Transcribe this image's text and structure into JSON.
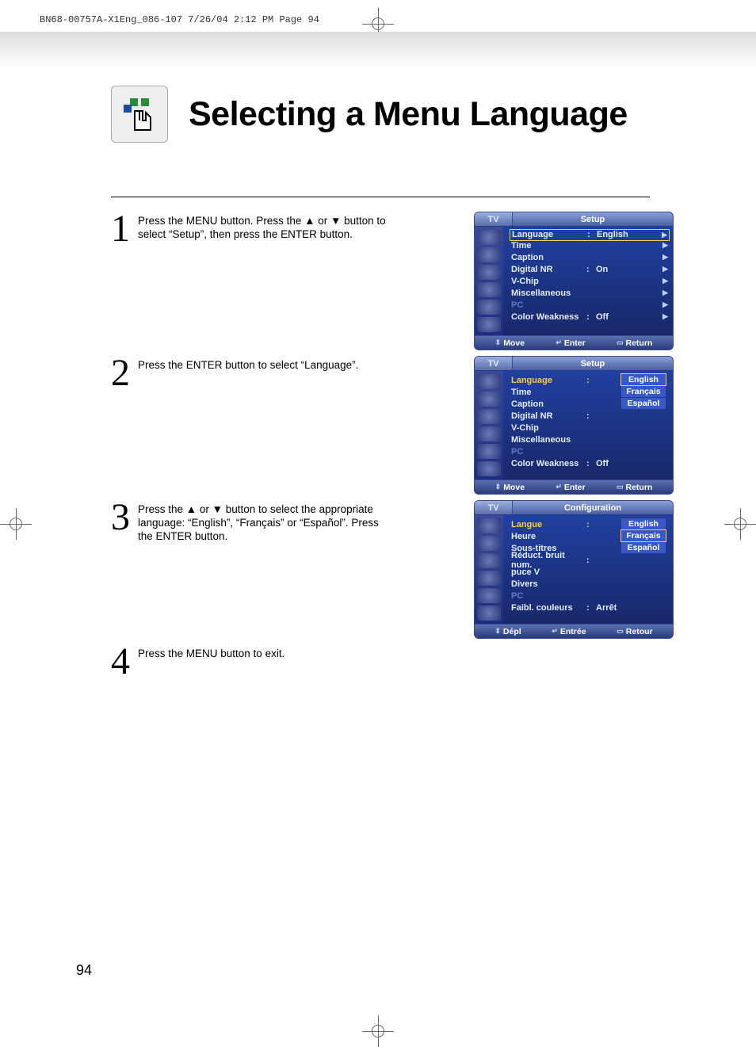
{
  "crop_header": "BN68-00757A-X1Eng_086-107  7/26/04  2:12 PM  Page 94",
  "page_title": "Selecting a Menu Language",
  "page_number": "94",
  "steps": {
    "s1": {
      "num": "1",
      "text": "Press the MENU button. Press the ▲ or ▼ button to select “Setup”, then press the ENTER button."
    },
    "s2": {
      "num": "2",
      "text": "Press the ENTER button to select “Language”."
    },
    "s3": {
      "num": "3",
      "text": "Press the ▲ or ▼ button to select the appropriate language: “English”, “Français” or “Español”. Press the ENTER button."
    },
    "s4": {
      "num": "4",
      "text": "Press the MENU button to exit."
    }
  },
  "osd1": {
    "tv": "TV",
    "title": "Setup",
    "rows": [
      {
        "label": "Language",
        "colon": ":",
        "val": "English",
        "arrow": "▶",
        "boxed": true
      },
      {
        "label": "Time",
        "arrow": "▶"
      },
      {
        "label": "Caption",
        "arrow": "▶"
      },
      {
        "label": "Digital NR",
        "colon": ":",
        "val": "On",
        "arrow": "▶"
      },
      {
        "label": "V-Chip",
        "arrow": "▶"
      },
      {
        "label": "Miscellaneous",
        "arrow": "▶"
      },
      {
        "label": "PC",
        "arrow": "▶",
        "dim": true
      },
      {
        "label": "Color Weakness",
        "colon": ":",
        "val": "Off",
        "arrow": "▶"
      }
    ],
    "hints": {
      "move": "Move",
      "enter": "Enter",
      "return": "Return"
    }
  },
  "osd2": {
    "tv": "TV",
    "title": "Setup",
    "rows": [
      {
        "label": "Language",
        "colon": ":",
        "hl": true
      },
      {
        "label": "Time"
      },
      {
        "label": "Caption"
      },
      {
        "label": "Digital NR",
        "colon": ":"
      },
      {
        "label": "V-Chip"
      },
      {
        "label": "Miscellaneous"
      },
      {
        "label": "PC",
        "dim": true
      },
      {
        "label": "Color Weakness",
        "colon": ":",
        "val": "Off"
      }
    ],
    "dropdown": [
      {
        "label": "English",
        "sel": true
      },
      {
        "label": "Français"
      },
      {
        "label": "Español"
      }
    ],
    "hints": {
      "move": "Move",
      "enter": "Enter",
      "return": "Return"
    }
  },
  "osd3": {
    "tv": "TV",
    "title": "Configuration",
    "rows": [
      {
        "label": "Langue",
        "colon": ":",
        "hl": true
      },
      {
        "label": "Heure"
      },
      {
        "label": "Sous-titres"
      },
      {
        "label": "Réduct. bruit num.",
        "colon": ":"
      },
      {
        "label": "puce V"
      },
      {
        "label": "Divers"
      },
      {
        "label": "PC",
        "dim": true
      },
      {
        "label": "Faibl. couleurs",
        "colon": ":",
        "val": "Arrêt"
      }
    ],
    "dropdown": [
      {
        "label": "English"
      },
      {
        "label": "Français",
        "sel": true
      },
      {
        "label": "Español"
      }
    ],
    "hints": {
      "move": "Dépl",
      "enter": "Entrée",
      "return": "Retour"
    }
  }
}
